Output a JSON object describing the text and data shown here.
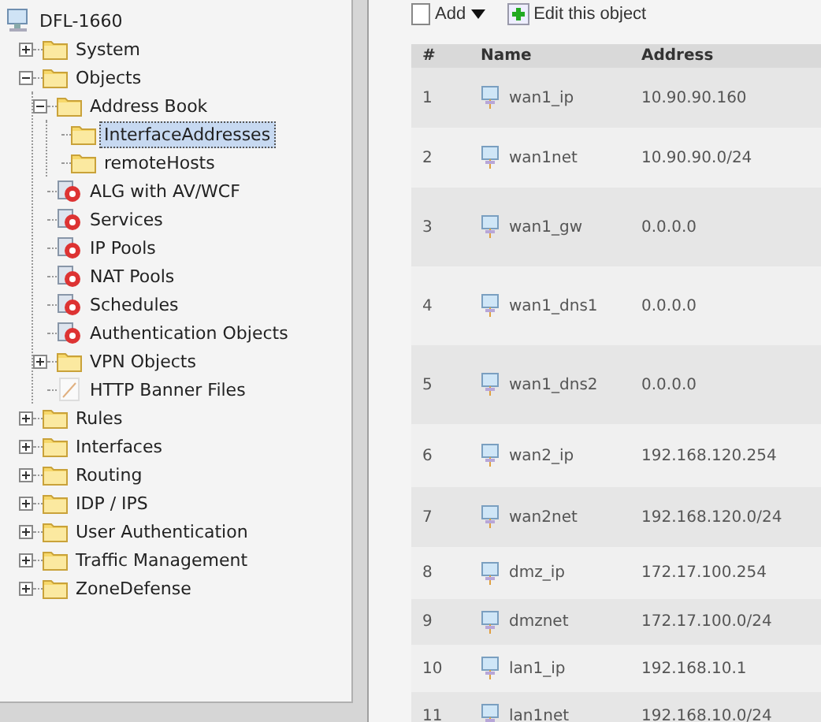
{
  "tree": {
    "label": "DFL-1660",
    "kind": "device",
    "selected": false,
    "children": [
      {
        "label": "System",
        "kind": "folder",
        "expanded": false,
        "selected": false
      },
      {
        "label": "Objects",
        "kind": "folder",
        "expanded": true,
        "selected": false,
        "children": [
          {
            "label": "Address Book",
            "kind": "folder",
            "expanded": true,
            "selected": false,
            "children": [
              {
                "label": "InterfaceAddresses",
                "kind": "folder",
                "selected": true
              },
              {
                "label": "remoteHosts",
                "kind": "folder",
                "selected": false
              }
            ]
          },
          {
            "label": "ALG with AV/WCF",
            "kind": "object",
            "selected": false
          },
          {
            "label": "Services",
            "kind": "object",
            "selected": false
          },
          {
            "label": "IP Pools",
            "kind": "object",
            "selected": false
          },
          {
            "label": "NAT Pools",
            "kind": "object",
            "selected": false
          },
          {
            "label": "Schedules",
            "kind": "object",
            "selected": false
          },
          {
            "label": "Authentication Objects",
            "kind": "object",
            "selected": false
          },
          {
            "label": "VPN Objects",
            "kind": "folder",
            "expanded": false,
            "selected": false
          },
          {
            "label": "HTTP Banner Files",
            "kind": "file",
            "selected": false
          }
        ]
      },
      {
        "label": "Rules",
        "kind": "folder",
        "expanded": false,
        "selected": false
      },
      {
        "label": "Interfaces",
        "kind": "folder",
        "expanded": false,
        "selected": false
      },
      {
        "label": "Routing",
        "kind": "folder",
        "expanded": false,
        "selected": false
      },
      {
        "label": "IDP / IPS",
        "kind": "folder",
        "expanded": false,
        "selected": false
      },
      {
        "label": "User Authentication",
        "kind": "folder",
        "expanded": false,
        "selected": false
      },
      {
        "label": "Traffic Management",
        "kind": "folder",
        "expanded": false,
        "selected": false
      },
      {
        "label": "ZoneDefense",
        "kind": "folder",
        "expanded": false,
        "selected": false
      }
    ]
  },
  "toolbar": [
    {
      "label": "Add",
      "kind": "add"
    },
    {
      "label": "Edit this object",
      "kind": "edit"
    }
  ],
  "table": {
    "columns": [
      "#",
      "Name",
      "Address"
    ],
    "rows": [
      {
        "number": "1",
        "name": "wan1_ip",
        "address": "10.90.90.160"
      },
      {
        "number": "2",
        "name": "wan1net",
        "address": "10.90.90.0/24"
      },
      {
        "number": "3",
        "name": "wan1_gw",
        "address": "0.0.0.0"
      },
      {
        "number": "4",
        "name": "wan1_dns1",
        "address": "0.0.0.0"
      },
      {
        "number": "5",
        "name": "wan1_dns2",
        "address": "0.0.0.0"
      },
      {
        "number": "6",
        "name": "wan2_ip",
        "address": "192.168.120.254"
      },
      {
        "number": "7",
        "name": "wan2net",
        "address": "192.168.120.0/24"
      },
      {
        "number": "8",
        "name": "dmz_ip",
        "address": "172.17.100.254"
      },
      {
        "number": "9",
        "name": "dmznet",
        "address": "172.17.100.0/24"
      },
      {
        "number": "10",
        "name": "lan1_ip",
        "address": "192.168.10.1"
      },
      {
        "number": "11",
        "name": "lan1net",
        "address": "192.168.10.0/24"
      }
    ]
  }
}
